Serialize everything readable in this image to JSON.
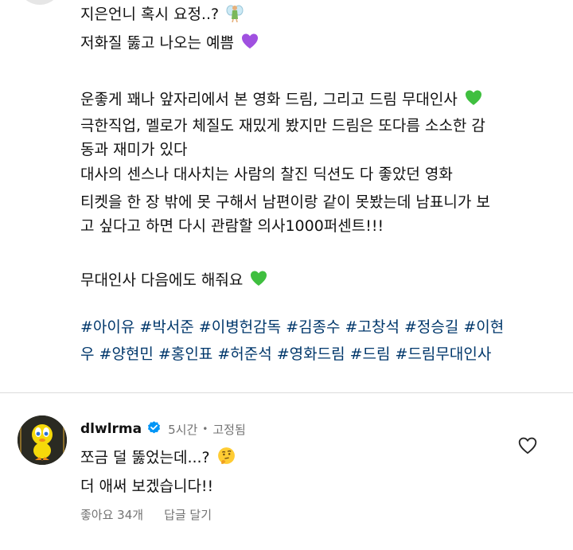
{
  "post": {
    "lines": [
      "지은언니 혹시 요정..?",
      "저화질 뚫고 나오는 예쁨",
      "운좋게 꽤나 앞자리에서 본 영화 드림, 그리고 드림 무대인사",
      "극한직업, 멜로가 체질도 재밌게 봤지만 드림은 또다름 소소한 감",
      "동과 재미가 있다",
      "대사의 센스나 대사치는 사람의 찰진 딕션도 다 좋았던 영화",
      "티켓을 한 장 밖에 못 구해서 남편이랑 같이 못봤는데 남표니가 보",
      "고 싶다고 하면 다시 관람할 의사1000퍼센트!!!",
      "무대인사 다음에도 해줘요"
    ],
    "hashtag_lines": [
      "#아이유 #박서준 #이병헌감독 #김종수 #고창석 #정승길 #이현",
      "우 #양현민 #홍인표 #허준석 #영화드림 #드림 #드림무대인사"
    ]
  },
  "comment": {
    "username": "dlwlrma",
    "time": "5시간",
    "separator": "•",
    "pinned": "고정됨",
    "lines": [
      "쪼금 덜 뚫었는데...?",
      "더 애써 보겠습니다!!"
    ],
    "likes": "좋아요 34개",
    "reply": "답글 달기"
  },
  "icons": {
    "line1": "fairy-emoji",
    "line2": "purple-heart-emoji",
    "line3": "green-heart-emoji",
    "line9": "green-heart-emoji",
    "comment_line1": "thinking-face-emoji",
    "verified": "verified-badge-icon",
    "like": "heart-outline-icon"
  },
  "colors": {
    "hashtag": "#00376b",
    "verified_blue": "#0095f6",
    "meta_gray": "#737373",
    "purple_heart": "#a050e0",
    "green_heart": "#3fbf3f"
  }
}
